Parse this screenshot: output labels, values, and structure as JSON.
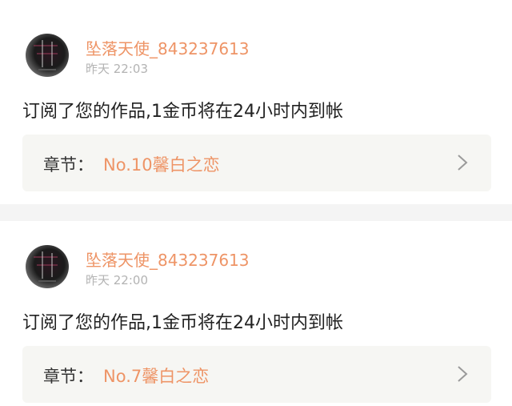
{
  "top_indicator_color": "#f06aa0",
  "accent_color": "#ee9466",
  "notifications": [
    {
      "avatar_icon": "user-avatar-icon",
      "username": "坠落天使_843237613",
      "time": "昨天 22:03",
      "message": "订阅了您的作品,1金币将在24小时内到帐",
      "chapter_label": "章节：",
      "chapter_title": "No.10馨白之恋",
      "chevron_icon": "chevron-right-icon"
    },
    {
      "avatar_icon": "user-avatar-icon",
      "username": "坠落天使_843237613",
      "time": "昨天 22:00",
      "message": "订阅了您的作品,1金币将在24小时内到帐",
      "chapter_label": "章节：",
      "chapter_title": "No.7馨白之恋",
      "chevron_icon": "chevron-right-icon"
    }
  ]
}
